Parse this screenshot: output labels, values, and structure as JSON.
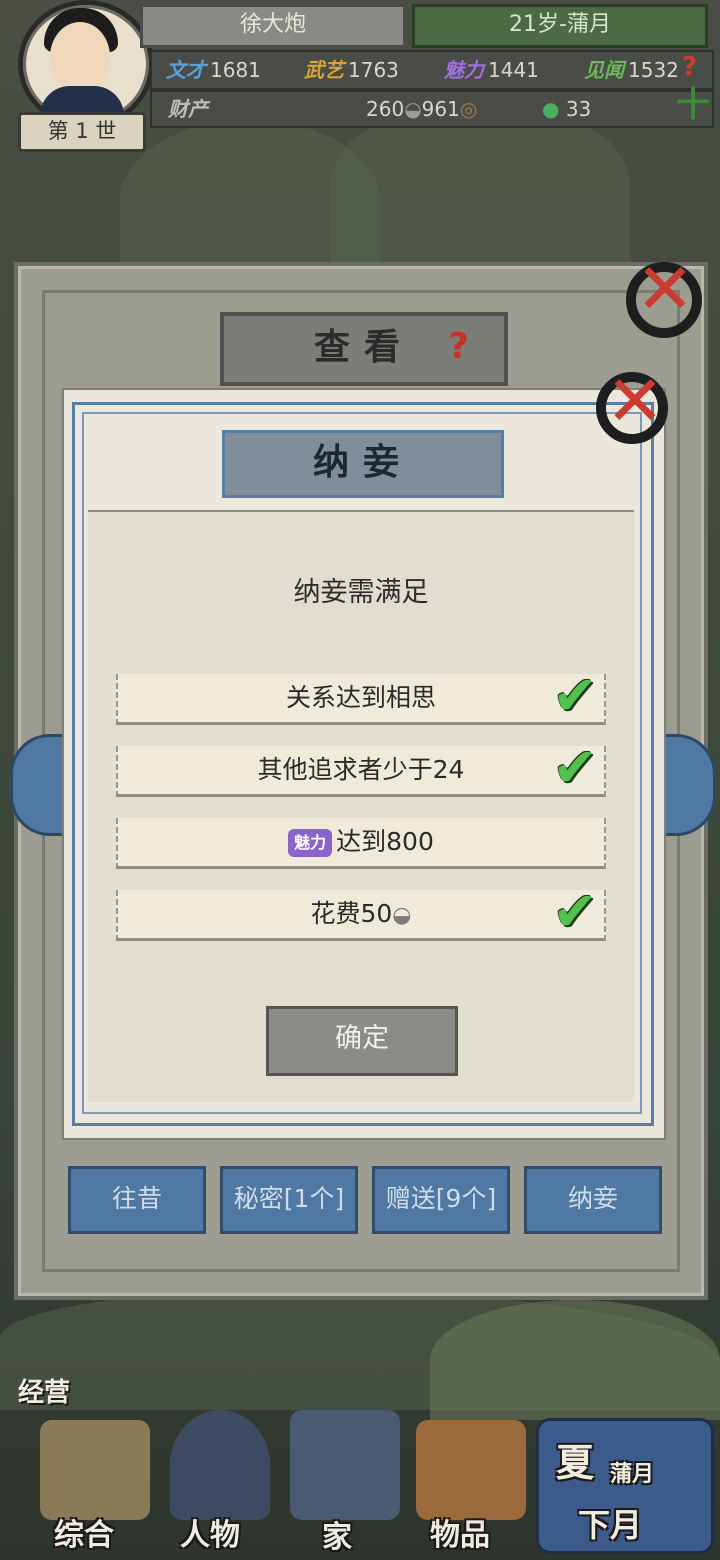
{
  "header": {
    "name": "徐大炮",
    "age_month": "21岁-蒲月",
    "generation": "第 1 世",
    "stats": [
      {
        "key": "文才",
        "value": "1681",
        "color": "#5aa0e0"
      },
      {
        "key": "武艺",
        "value": "1763",
        "color": "#d9a23a"
      },
      {
        "key": "魅力",
        "value": "1441",
        "color": "#a070e0"
      },
      {
        "key": "见闻",
        "value": "1532",
        "color": "#6cb858"
      }
    ],
    "wealth_label": "财产",
    "silver": "260",
    "copper": "961",
    "jade": "33"
  },
  "outer_dialog": {
    "title": "查看",
    "tabs": [
      "往昔",
      "秘密[1个]",
      "赠送[9个]",
      "纳妾"
    ]
  },
  "inner_dialog": {
    "title": "纳妾",
    "requirement_title": "纳妾需满足",
    "conditions": [
      {
        "text": "关系达到相思",
        "met": true
      },
      {
        "text": "其他追求者少于24",
        "met": true
      },
      {
        "badge": "魅力",
        "text": "达到800",
        "met": false
      },
      {
        "text": "花费50",
        "met": true
      }
    ],
    "confirm_label": "确定"
  },
  "left_label": "经营",
  "bottom_nav": [
    "综合",
    "人物",
    "家",
    "物品"
  ],
  "season": {
    "season": "夏",
    "month": "蒲月",
    "next": "下月"
  }
}
